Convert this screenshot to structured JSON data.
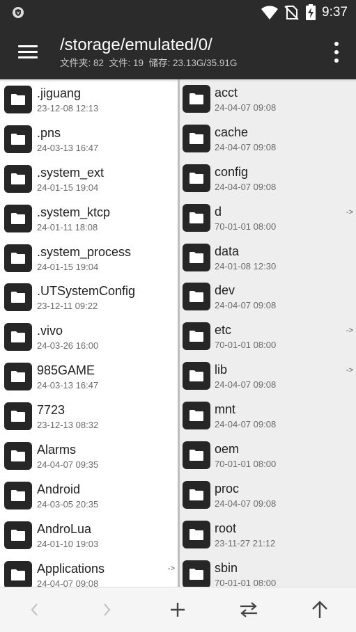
{
  "status_bar": {
    "time": "9:37"
  },
  "toolbar": {
    "path": "/storage/emulated/0/",
    "stats": "文件夹: 82  文件: 19  储存: 23.13G/35.91G"
  },
  "left_pane": {
    "items": [
      {
        "name": ".jiguang",
        "date": "23-12-08 12:13",
        "link": ""
      },
      {
        "name": ".pns",
        "date": "24-03-13 16:47",
        "link": ""
      },
      {
        "name": ".system_ext",
        "date": "24-01-15 19:04",
        "link": ""
      },
      {
        "name": ".system_ktcp",
        "date": "24-01-11 18:08",
        "link": ""
      },
      {
        "name": ".system_process",
        "date": "24-01-15 19:04",
        "link": ""
      },
      {
        "name": ".UTSystemConfig",
        "date": "23-12-11 09:22",
        "link": ""
      },
      {
        "name": ".vivo",
        "date": "24-03-26 16:00",
        "link": ""
      },
      {
        "name": "985GAME",
        "date": "24-03-13 16:47",
        "link": ""
      },
      {
        "name": "7723",
        "date": "23-12-13 08:32",
        "link": ""
      },
      {
        "name": "Alarms",
        "date": "24-04-07 09:35",
        "link": ""
      },
      {
        "name": "Android",
        "date": "24-03-05 20:35",
        "link": ""
      },
      {
        "name": "AndroLua",
        "date": "24-01-10 19:03",
        "link": ""
      },
      {
        "name": "Applications",
        "date": "24-04-07 09:08",
        "link": "->"
      }
    ]
  },
  "right_pane": {
    "items": [
      {
        "name": "acct",
        "date": "24-04-07 09:08",
        "link": ""
      },
      {
        "name": "cache",
        "date": "24-04-07 09:08",
        "link": ""
      },
      {
        "name": "config",
        "date": "24-04-07 09:08",
        "link": ""
      },
      {
        "name": "d",
        "date": "70-01-01 08:00",
        "link": "->"
      },
      {
        "name": "data",
        "date": "24-01-08 12:30",
        "link": ""
      },
      {
        "name": "dev",
        "date": "24-04-07 09:08",
        "link": ""
      },
      {
        "name": "etc",
        "date": "70-01-01 08:00",
        "link": "->"
      },
      {
        "name": "lib",
        "date": "24-04-07 09:08",
        "link": "->"
      },
      {
        "name": "mnt",
        "date": "24-04-07 09:08",
        "link": ""
      },
      {
        "name": "oem",
        "date": "70-01-01 08:00",
        "link": ""
      },
      {
        "name": "proc",
        "date": "24-04-07 09:08",
        "link": ""
      },
      {
        "name": "root",
        "date": "23-11-27 21:12",
        "link": ""
      },
      {
        "name": "sbin",
        "date": "70-01-01 08:00",
        "link": ""
      }
    ]
  },
  "bottom_nav": [
    {
      "icon": "back-icon",
      "enabled": false
    },
    {
      "icon": "forward-icon",
      "enabled": false
    },
    {
      "icon": "add-icon",
      "enabled": true
    },
    {
      "icon": "swap-icon",
      "enabled": true
    },
    {
      "icon": "up-icon",
      "enabled": true
    }
  ],
  "colors": {
    "toolbar_bg": "#2b2b2b",
    "left_pane_bg": "#ffffff",
    "right_pane_bg": "#eeeeee",
    "folder_icon_bg": "#262626"
  }
}
